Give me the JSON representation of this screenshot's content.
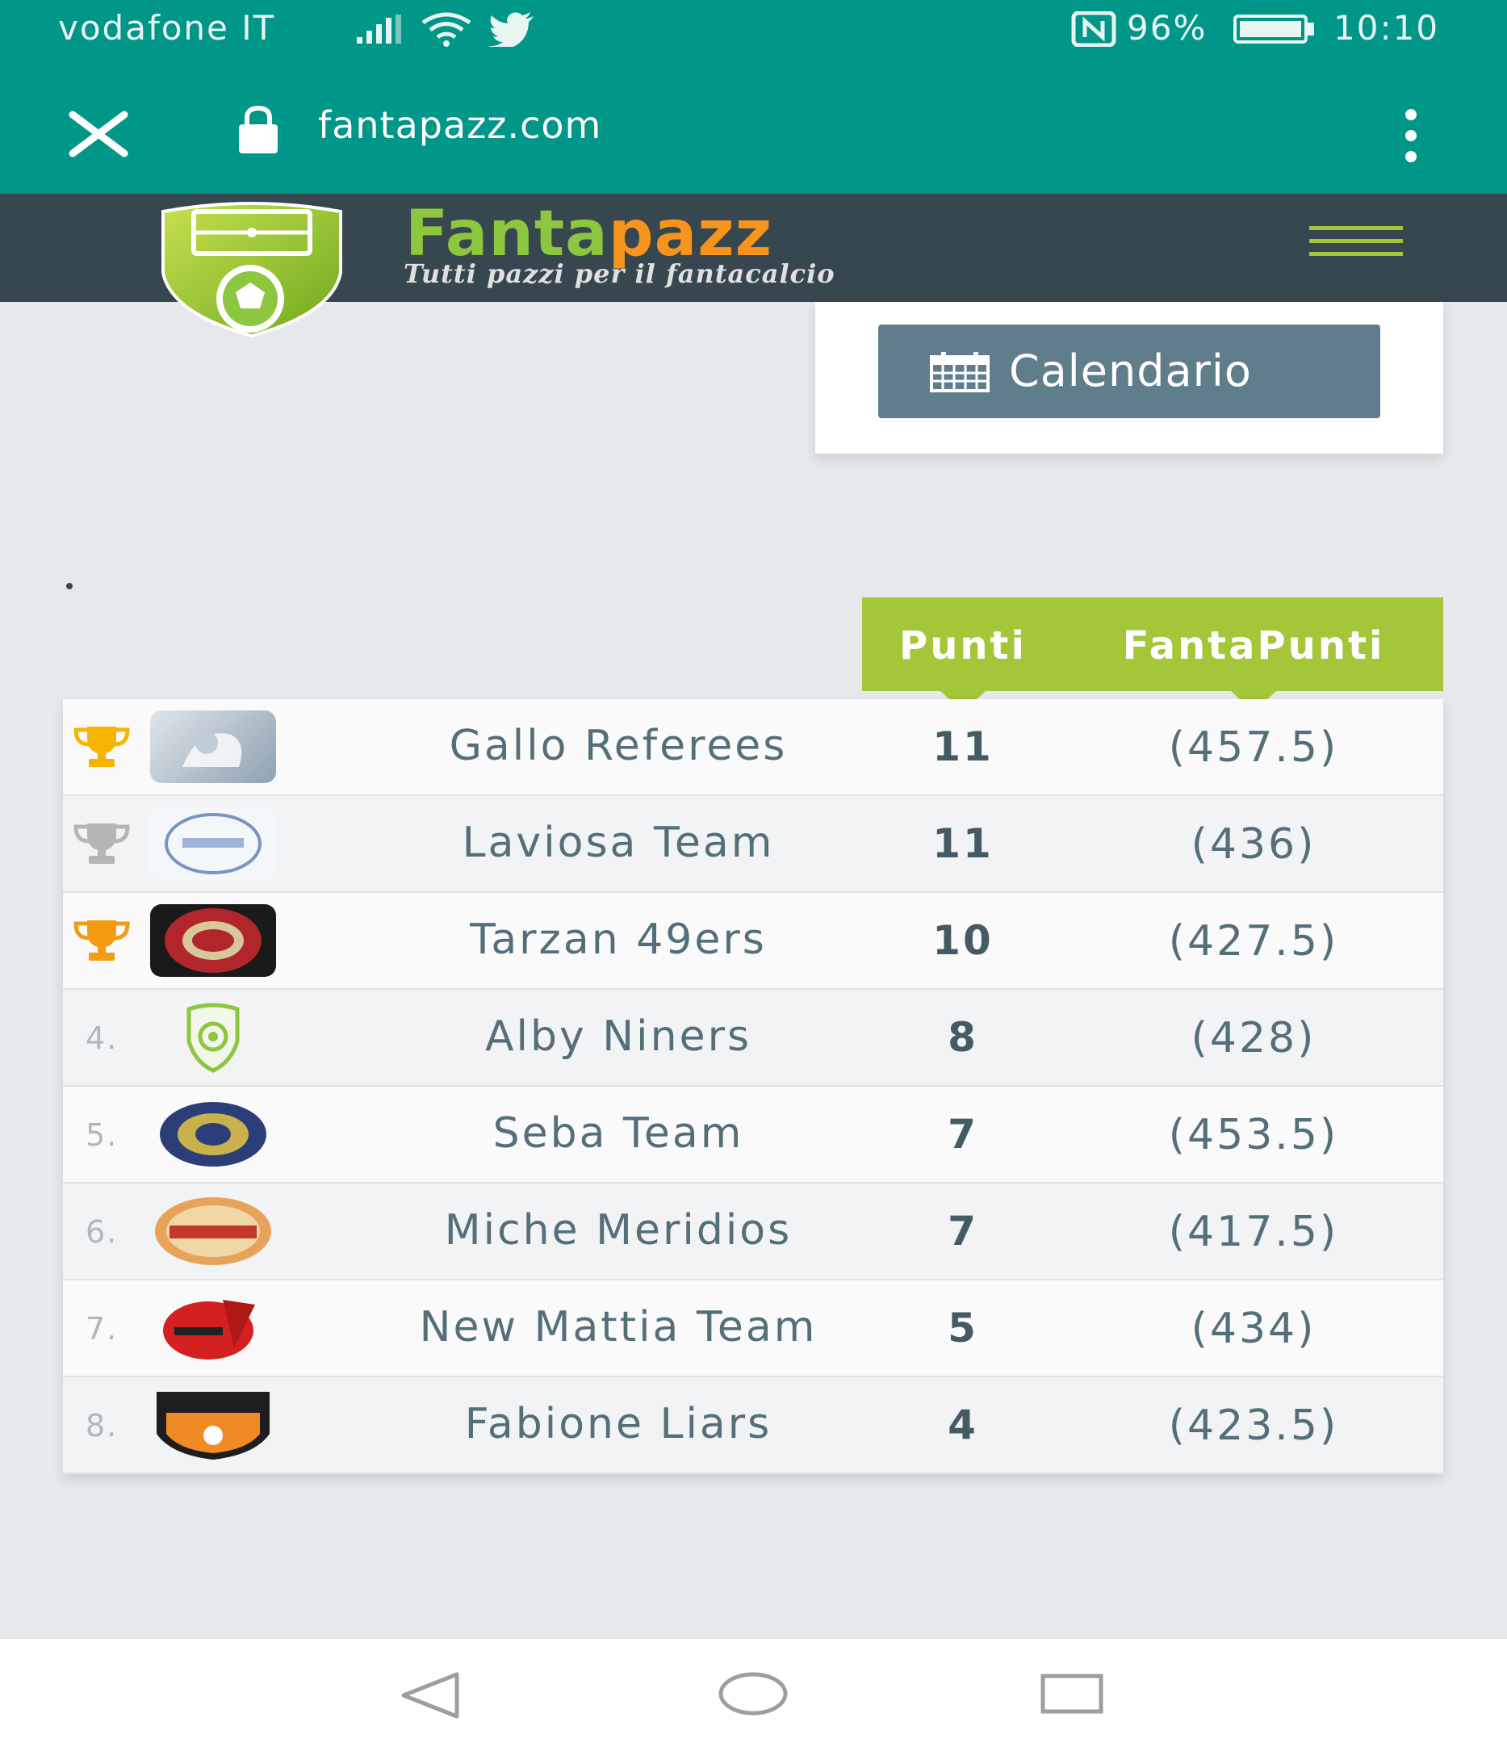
{
  "status_bar": {
    "carrier": "vodafone IT",
    "battery": "96%",
    "time": "10:10"
  },
  "browser": {
    "url": "fantapazz.com"
  },
  "site": {
    "brand_part1": "Fanta",
    "brand_part2": "pazz",
    "tagline": "Tutti pazzi per il fantacalcio",
    "colors": {
      "green": "#a4c639",
      "orange": "#f7941d",
      "header": "#37474f",
      "teal": "#009688"
    }
  },
  "calendar_button": {
    "label": "Calendario",
    "icon": "calendar-icon"
  },
  "table": {
    "headers": {
      "points": "Punti",
      "fanta_points": "FantaPunti"
    },
    "rows": [
      {
        "rank": "",
        "trophy": "gold",
        "team": "Gallo Referees",
        "points": "11",
        "fanta_points": "(457.5)"
      },
      {
        "rank": "",
        "trophy": "silver",
        "team": "Laviosa Team",
        "points": "11",
        "fanta_points": "(436)"
      },
      {
        "rank": "",
        "trophy": "bronze",
        "team": "Tarzan 49ers",
        "points": "10",
        "fanta_points": "(427.5)"
      },
      {
        "rank": "4.",
        "trophy": "",
        "team": "Alby Niners",
        "points": "8",
        "fanta_points": "(428)"
      },
      {
        "rank": "5.",
        "trophy": "",
        "team": "Seba Team",
        "points": "7",
        "fanta_points": "(453.5)"
      },
      {
        "rank": "6.",
        "trophy": "",
        "team": "Miche Meridios",
        "points": "7",
        "fanta_points": "(417.5)"
      },
      {
        "rank": "7.",
        "trophy": "",
        "team": "New Mattia Team",
        "points": "5",
        "fanta_points": "(434)"
      },
      {
        "rank": "8.",
        "trophy": "",
        "team": "Fabione Liars",
        "points": "4",
        "fanta_points": "(423.5)"
      }
    ]
  }
}
